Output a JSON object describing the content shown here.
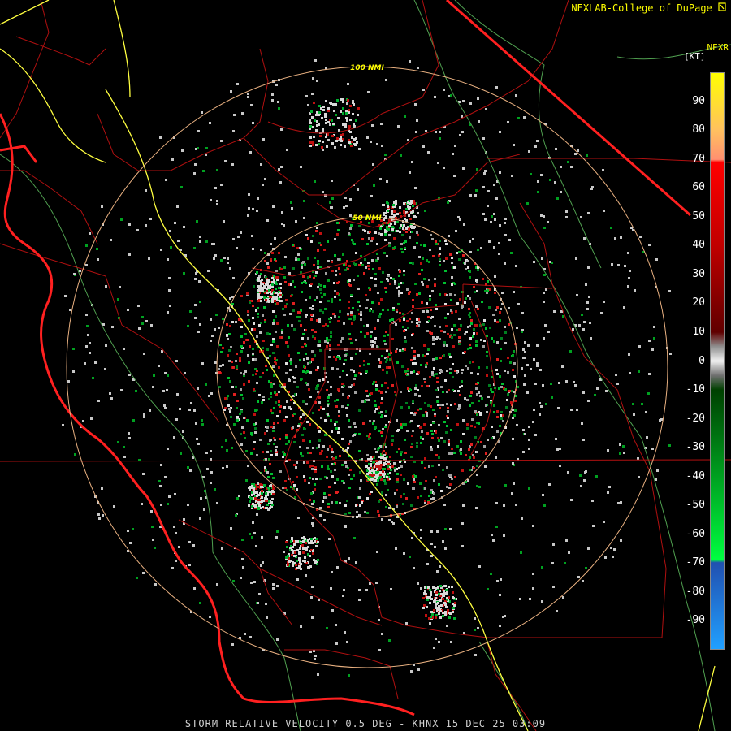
{
  "header": {
    "credit": "NEXLAB-College of DuPage",
    "credit_logo_icon": "cod-logo-icon",
    "product_code": "NEXR"
  },
  "legend": {
    "unit": "[KT]",
    "ticks": [
      "90",
      "80",
      "70",
      "60",
      "50",
      "40",
      "30",
      "20",
      "10",
      "0",
      "-10",
      "-20",
      "-30",
      "-40",
      "-50",
      "-60",
      "-70",
      "-80",
      "-90"
    ],
    "tick_values": [
      90,
      80,
      70,
      60,
      50,
      40,
      30,
      20,
      10,
      0,
      -10,
      -20,
      -30,
      -40,
      -50,
      -60,
      -70,
      -80,
      -90
    ],
    "range": [
      -100,
      100
    ],
    "stops": [
      {
        "value": 100,
        "color": "#ffff00"
      },
      {
        "value": 80,
        "color": "#ffc060"
      },
      {
        "value": 70,
        "color": "#ff9070"
      },
      {
        "value": 69,
        "color": "#ff0000"
      },
      {
        "value": 40,
        "color": "#c00000"
      },
      {
        "value": 10,
        "color": "#600000"
      },
      {
        "value": 5,
        "color": "#909090"
      },
      {
        "value": 0,
        "color": "#f0f0f0"
      },
      {
        "value": -5,
        "color": "#707070"
      },
      {
        "value": -10,
        "color": "#004000"
      },
      {
        "value": -40,
        "color": "#00a020"
      },
      {
        "value": -69,
        "color": "#00ff40"
      },
      {
        "value": -70,
        "color": "#2050b0"
      },
      {
        "value": -100,
        "color": "#20a0ff"
      }
    ]
  },
  "range_rings": [
    {
      "label": "100 NMI",
      "nmi": 100
    },
    {
      "label": "50 NMI",
      "nmi": 50
    }
  ],
  "footer": {
    "product": "STORM RELATIVE VELOCITY 0.5 DEG - KHNX 15 DEC 25 03:09"
  },
  "colors": {
    "background": "#000000",
    "ring": "#e8b080",
    "county": "#b01010",
    "coast": "#ff2020",
    "highway": "#ffff40",
    "boundary_green": "#50a050",
    "label": "#ffff00"
  }
}
